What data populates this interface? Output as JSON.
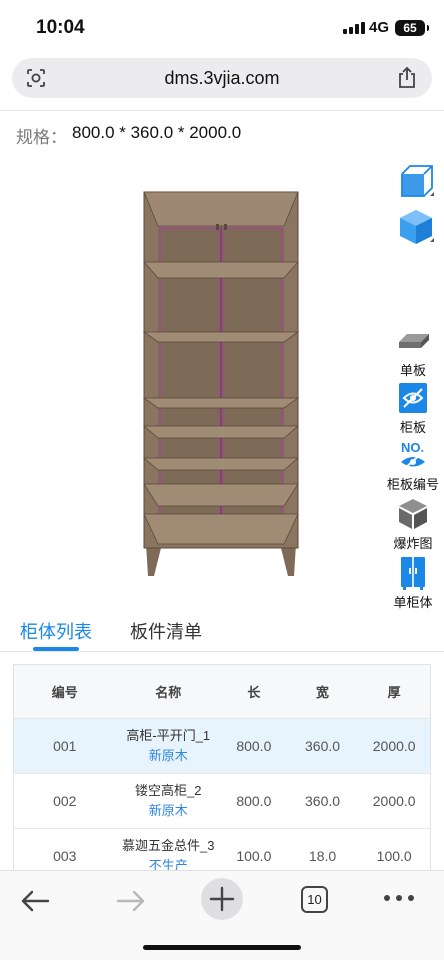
{
  "status": {
    "time": "10:04",
    "network": "4G",
    "battery": "65"
  },
  "browser": {
    "url": "dms.3vjia.com"
  },
  "spec": {
    "label": "规格：",
    "value": "800.0 * 360.0 * 2000.0"
  },
  "tools": [
    {
      "label": "单板",
      "icon": "single-board-icon"
    },
    {
      "label": "柜板",
      "icon": "cabinet-board-hide-icon"
    },
    {
      "label": "柜板编号",
      "icon": "board-number-icon"
    },
    {
      "label": "爆炸图",
      "icon": "exploded-view-icon"
    },
    {
      "label": "单柜体",
      "icon": "single-cabinet-icon"
    }
  ],
  "tabs": [
    {
      "label": "柜体列表",
      "active": true
    },
    {
      "label": "板件清单",
      "active": false
    }
  ],
  "table": {
    "headers": {
      "code": "编号",
      "name": "名称",
      "length": "长",
      "width": "宽",
      "thickness": "厚"
    },
    "rows": [
      {
        "code": "001",
        "name": "高柜-平开门_1",
        "material": "新原木",
        "length": "800.0",
        "width": "360.0",
        "thickness": "2000.0"
      },
      {
        "code": "002",
        "name": "镂空高柜_2",
        "material": "新原木",
        "length": "800.0",
        "width": "360.0",
        "thickness": "2000.0"
      },
      {
        "code": "003",
        "name": "慕迦五金总件_3",
        "material": "不生产",
        "length": "100.0",
        "width": "18.0",
        "thickness": "100.0"
      }
    ]
  },
  "bottom_bar": {
    "tab_count": "10"
  },
  "colors": {
    "accent": "#1b87e6",
    "wood": "#8a7560",
    "selected_row": "#e7f3fd"
  }
}
